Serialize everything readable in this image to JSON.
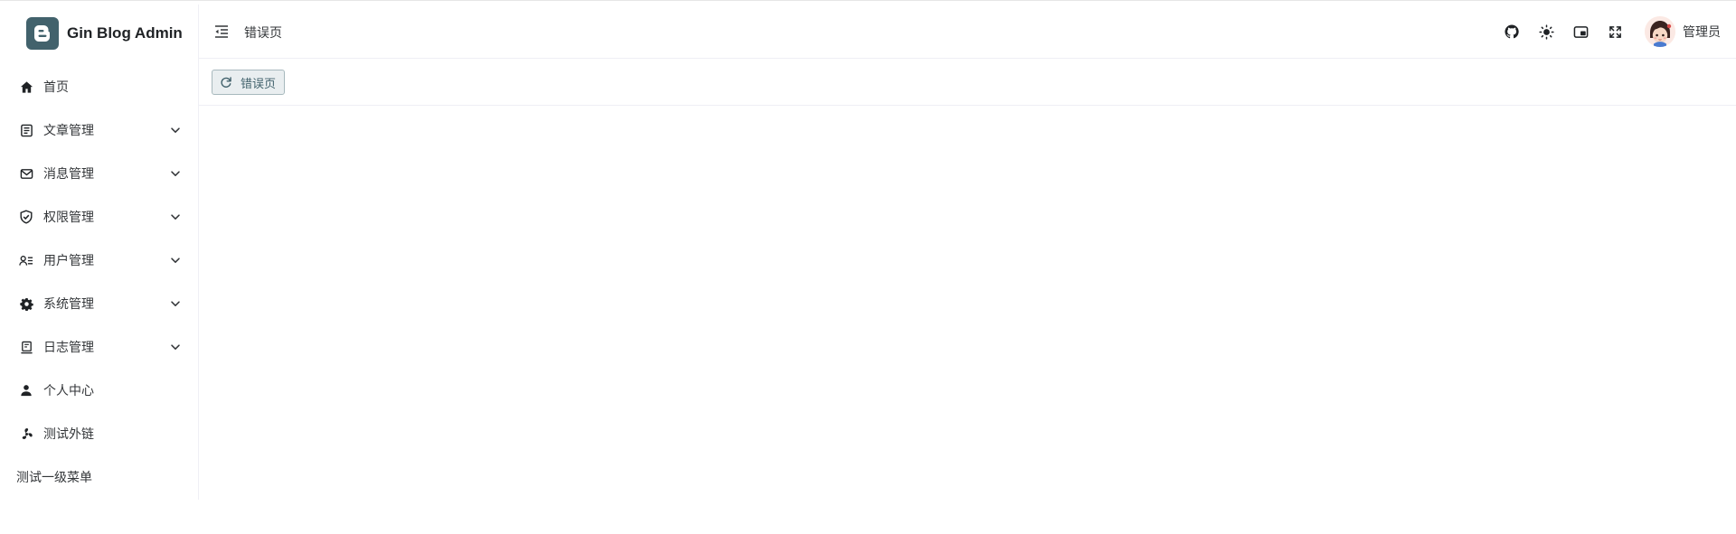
{
  "app": {
    "title": "Gin Blog Admin",
    "brand_color": "#42626c"
  },
  "sidebar": {
    "items": [
      {
        "label": "首页",
        "icon": "home-icon",
        "expandable": false
      },
      {
        "label": "文章管理",
        "icon": "article-icon",
        "expandable": true
      },
      {
        "label": "消息管理",
        "icon": "mail-icon",
        "expandable": true
      },
      {
        "label": "权限管理",
        "icon": "shield-check-icon",
        "expandable": true
      },
      {
        "label": "用户管理",
        "icon": "user-list-icon",
        "expandable": true
      },
      {
        "label": "系统管理",
        "icon": "gear-icon",
        "expandable": true
      },
      {
        "label": "日志管理",
        "icon": "log-icon",
        "expandable": true
      },
      {
        "label": "个人中心",
        "icon": "person-icon",
        "expandable": false
      },
      {
        "label": "测试外链",
        "icon": "fan-icon",
        "expandable": false
      },
      {
        "label": "测试一级菜单",
        "icon": null,
        "expandable": false
      }
    ]
  },
  "header": {
    "breadcrumb": "错误页",
    "icons": [
      "github-icon",
      "theme-sun-icon",
      "picture-in-picture-icon",
      "fullscreen-icon"
    ],
    "user": {
      "name": "管理员"
    }
  },
  "tabs": {
    "items": [
      {
        "label": "错误页",
        "active": true
      }
    ]
  }
}
